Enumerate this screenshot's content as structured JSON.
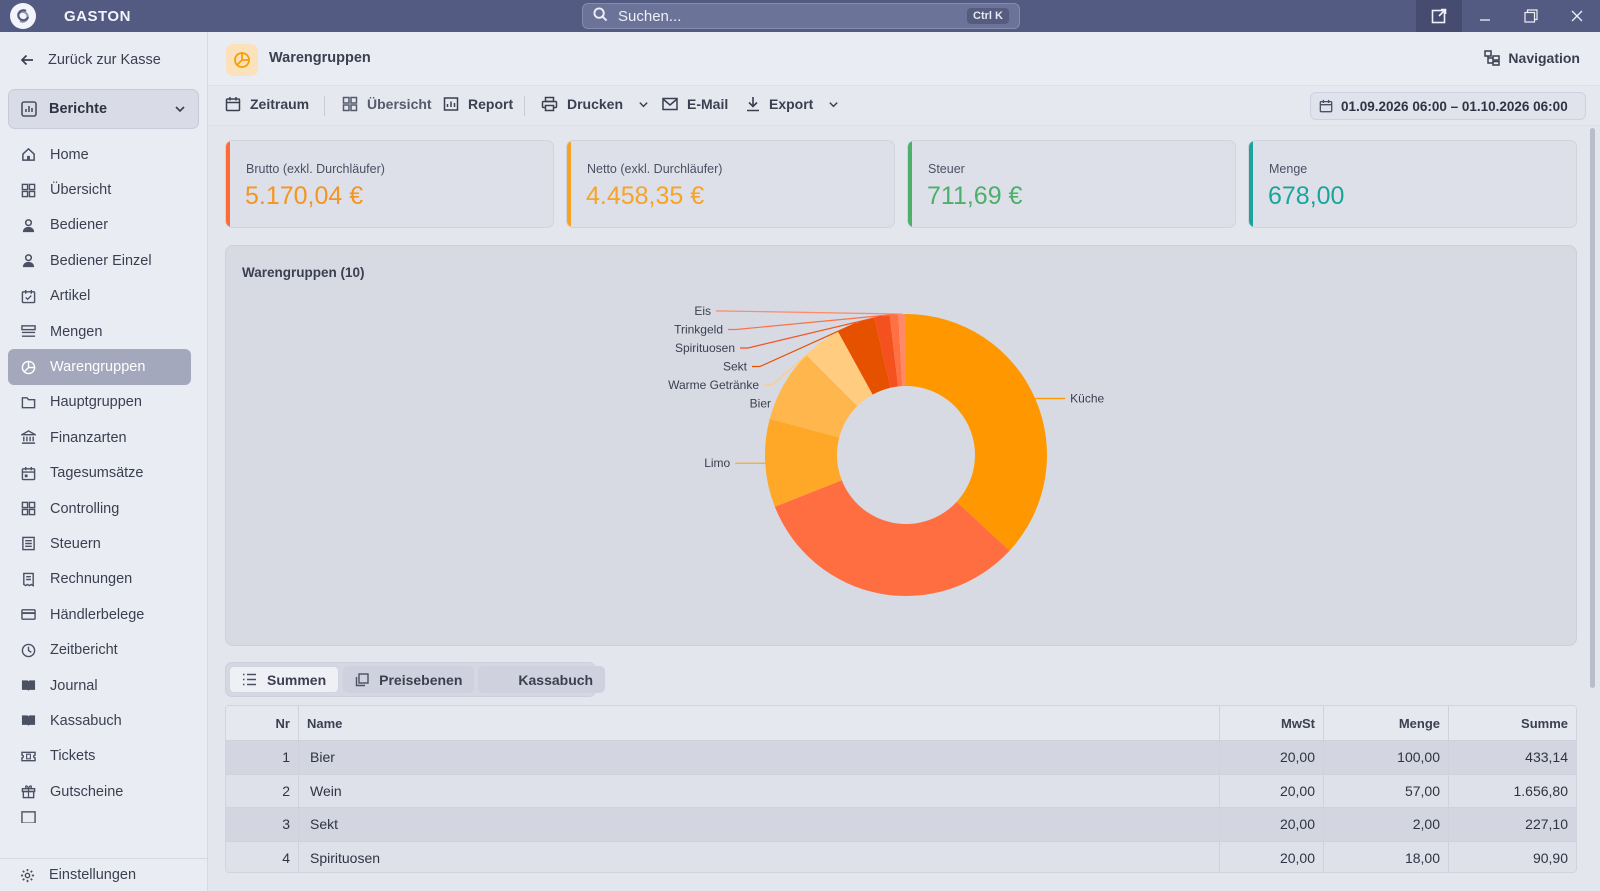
{
  "app": {
    "name": "GASTON"
  },
  "search": {
    "placeholder": "Suchen...",
    "shortcut": "Ctrl K"
  },
  "sidebar": {
    "back_label": "Zurück zur Kasse",
    "section": "Berichte",
    "items": [
      {
        "label": "Home",
        "icon": "home-icon"
      },
      {
        "label": "Übersicht",
        "icon": "dashboard-icon"
      },
      {
        "label": "Bediener",
        "icon": "user-icon"
      },
      {
        "label": "Bediener Einzel",
        "icon": "user-icon"
      },
      {
        "label": "Artikel",
        "icon": "tag-icon"
      },
      {
        "label": "Mengen",
        "icon": "list-icon"
      },
      {
        "label": "Warengruppen",
        "icon": "pie-icon",
        "active": true
      },
      {
        "label": "Hauptgruppen",
        "icon": "folder-icon"
      },
      {
        "label": "Finanzarten",
        "icon": "bank-icon"
      },
      {
        "label": "Tagesumsätze",
        "icon": "calendar-icon"
      },
      {
        "label": "Controlling",
        "icon": "dashboard-icon"
      },
      {
        "label": "Steuern",
        "icon": "document-icon"
      },
      {
        "label": "Rechnungen",
        "icon": "receipt-icon"
      },
      {
        "label": "Händlerbelege",
        "icon": "card-icon"
      },
      {
        "label": "Zeitbericht",
        "icon": "clock-icon"
      },
      {
        "label": "Journal",
        "icon": "book-icon"
      },
      {
        "label": "Kassabuch",
        "icon": "book-icon"
      },
      {
        "label": "Tickets",
        "icon": "ticket-icon"
      },
      {
        "label": "Gutscheine",
        "icon": "gift-icon"
      }
    ],
    "settings_label": "Einstellungen"
  },
  "header": {
    "title": "Warengruppen",
    "navigation_label": "Navigation"
  },
  "toolbar": {
    "zeitraum": "Zeitraum",
    "uebersicht": "Übersicht",
    "report": "Report",
    "drucken": "Drucken",
    "email": "E-Mail",
    "export": "Export",
    "date_range": "01.09.2026 06:00 – 01.10.2026 06:00"
  },
  "kpis": [
    {
      "label": "Brutto (exkl. Durchläufer)",
      "value": "5.170,04 €",
      "color": "#ff6b35"
    },
    {
      "label": "Netto (exkl. Durchläufer)",
      "value": "4.458,35 €",
      "color": "#f8a325"
    },
    {
      "label": "Steuer",
      "value": "711,69 €",
      "color": "#4caf6a"
    },
    {
      "label": "Menge",
      "value": "678,00",
      "color": "#1aa59a"
    }
  ],
  "chart_panel": {
    "title": "Warengruppen (10)"
  },
  "chart_data": {
    "type": "pie",
    "donut": true,
    "categories": [
      "Küche",
      "Wein",
      "Limo",
      "Bier",
      "Warme Getränke",
      "Sekt",
      "Spirituosen",
      "Trinkgeld",
      "Eis"
    ],
    "labels_shown": [
      "Küche",
      "Limo",
      "Bier",
      "Warme Getränke",
      "Sekt",
      "Spirituosen",
      "Trinkgeld",
      "Eis"
    ],
    "values": [
      1900,
      1656.8,
      520,
      433.14,
      230,
      227.1,
      90.9,
      50,
      45
    ],
    "colors": [
      "#ff9800",
      "#ff6e40",
      "#ffa726",
      "#ffb74d",
      "#ffcc80",
      "#e65100",
      "#f4511e",
      "#ff7043",
      "#ff8a65"
    ]
  },
  "tabs": [
    {
      "label": "Summen",
      "icon": "list-icon",
      "active": true
    },
    {
      "label": "Preisebenen",
      "icon": "copy-icon"
    },
    {
      "label": "Kassabuch"
    }
  ],
  "table": {
    "columns": [
      "Nr",
      "Name",
      "MwSt",
      "Menge",
      "Summe"
    ],
    "rows": [
      {
        "nr": "1",
        "name": "Bier",
        "mwst": "20,00",
        "menge": "100,00",
        "summe": "433,14"
      },
      {
        "nr": "2",
        "name": "Wein",
        "mwst": "20,00",
        "menge": "57,00",
        "summe": "1.656,80"
      },
      {
        "nr": "3",
        "name": "Sekt",
        "mwst": "20,00",
        "menge": "2,00",
        "summe": "227,10"
      },
      {
        "nr": "4",
        "name": "Spirituosen",
        "mwst": "20,00",
        "menge": "18,00",
        "summe": "90,90"
      }
    ]
  }
}
